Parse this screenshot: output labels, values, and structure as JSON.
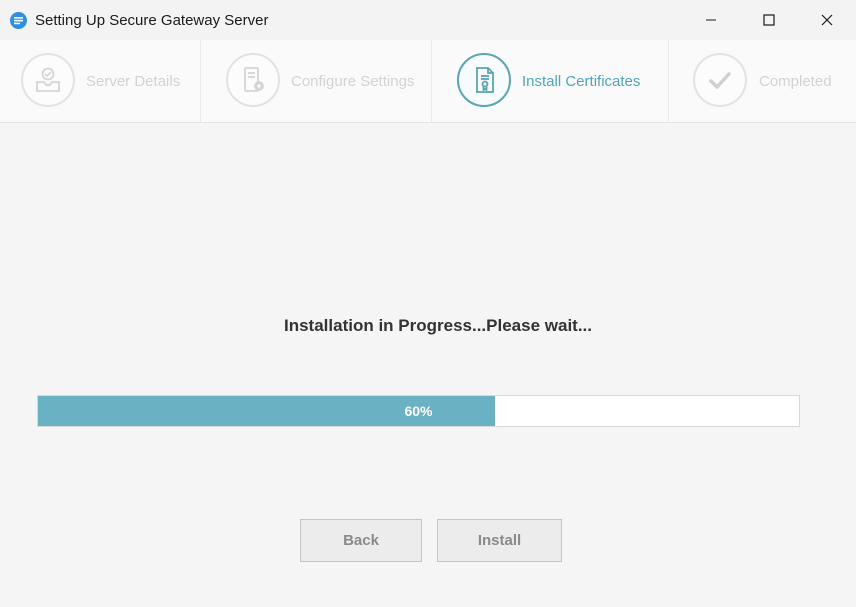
{
  "window": {
    "title": "Setting Up Secure Gateway Server",
    "accent": "#5aa4b4"
  },
  "steps": [
    {
      "label": "Server Details",
      "icon": "inbox-check-icon",
      "state": "inactive"
    },
    {
      "label": "Configure Settings",
      "icon": "server-gear-icon",
      "state": "inactive"
    },
    {
      "label": "Install Certificates",
      "icon": "certificate-icon",
      "state": "active"
    },
    {
      "label": "Completed",
      "icon": "checkmark-icon",
      "state": "inactive"
    }
  ],
  "main": {
    "status": "Installation in Progress...Please wait...",
    "progress": {
      "value": 60,
      "label": "60%",
      "fill_color": "#6ab1c3"
    }
  },
  "buttons": {
    "back": "Back",
    "install": "Install"
  }
}
